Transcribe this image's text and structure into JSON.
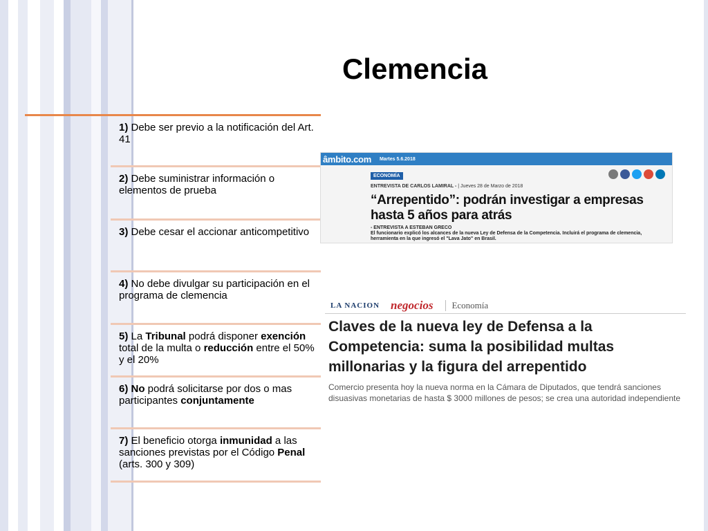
{
  "slide": {
    "title": "Clemencia"
  },
  "items": [
    {
      "num": "1)",
      "parts": [
        {
          "t": " Debe ser previo a la notificación del Art. 41",
          "b": false
        }
      ]
    },
    {
      "num": "2)",
      "parts": [
        {
          "t": " Debe suministrar información o elementos de prueba",
          "b": false
        }
      ]
    },
    {
      "num": "3)",
      "parts": [
        {
          "t": " Debe cesar el accionar anticompetitivo",
          "b": false
        }
      ]
    },
    {
      "num": "4)",
      "parts": [
        {
          "t": " No debe divulgar su participación en el programa de clemencia",
          "b": false
        }
      ]
    },
    {
      "num": "5)",
      "parts": [
        {
          "t": " La ",
          "b": false
        },
        {
          "t": "Tribunal",
          "b": true
        },
        {
          "t": " podrá disponer ",
          "b": false
        },
        {
          "t": "exención",
          "b": true
        },
        {
          "t": " total de la multa o ",
          "b": false
        },
        {
          "t": "reducción",
          "b": true
        },
        {
          "t": " entre el 50% y el 20%",
          "b": false
        }
      ]
    },
    {
      "num": "6)",
      "parts": [
        {
          "t": " ",
          "b": false
        },
        {
          "t": "No",
          "b": true
        },
        {
          "t": " podrá solicitarse por dos o mas participantes ",
          "b": false
        },
        {
          "t": "conjuntamente",
          "b": true
        }
      ]
    },
    {
      "num": "7)",
      "parts": [
        {
          "t": " El beneficio otorga ",
          "b": false
        },
        {
          "t": "inmunidad",
          "b": true
        },
        {
          "t": " a las sanciones previstas por el Código ",
          "b": false
        },
        {
          "t": "Penal",
          "b": true
        },
        {
          "t": " (arts. 300 y 309)",
          "b": false
        }
      ]
    }
  ],
  "ambito": {
    "logo": "âmbito.com",
    "date": "Martes 5.6.2018",
    "tag": "ECONOMÍA",
    "byline_label": "ENTREVISTA DE CARLOS LAMIRAL -",
    "byline_date": "|  Jueves 28 de Marzo de 2018",
    "headline": "“Arrepentido”: podrán investigar a empresas hasta 5 años para atrás",
    "sub_author": "- ENTREVISTA A ESTEBAN GRECO",
    "sub_text": "El funcionario explicó los alcances de la nueva Ley de Defensa de la Competencia. Incluirá el programa de clemencia, herramienta en la que ingresó el \"Lava Jato\" en Brasil.",
    "social_colors": [
      "#7a7a7a",
      "#3b5998",
      "#1da1f2",
      "#dd4b39",
      "#0077b5"
    ]
  },
  "nacion": {
    "brand": "LA NACION",
    "section": "negocios",
    "subsection": "Economía",
    "headline": "Claves de la nueva ley de Defensa a la Competencia: suma la posibilidad multas millonarias y la figura del arrepentido",
    "sub": "Comercio presenta hoy la nueva norma en la Cámara de Diputados, que tendrá sanciones disuasivas monetarias de hasta $ 3000 millones de pesos; se crea una autoridad independiente"
  }
}
